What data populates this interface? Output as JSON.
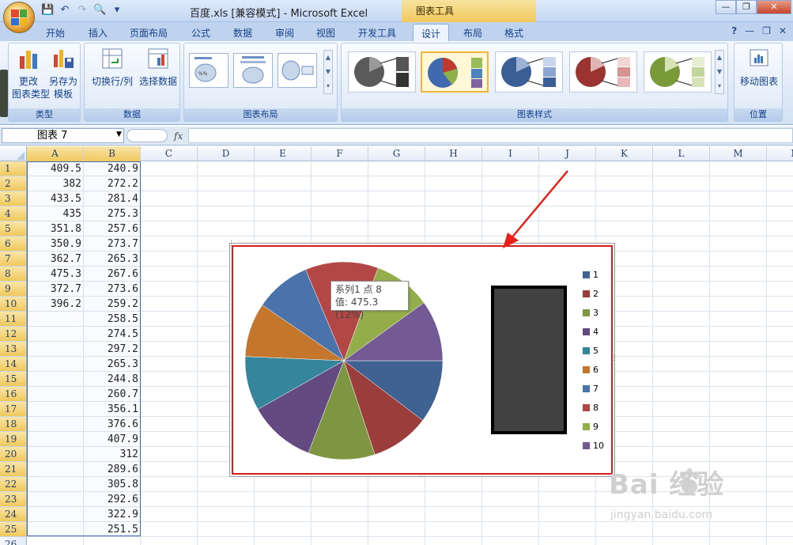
{
  "window": {
    "title": "百度.xls  [兼容模式] - Microsoft Excel",
    "tool_context": "图表工具",
    "controls": {
      "minimize": "—",
      "restore": "❐",
      "close": "✕"
    }
  },
  "quick_access": {
    "save": "💾",
    "undo": "↶",
    "redo": "↷",
    "print_preview": "🔍",
    "customize": "▾"
  },
  "ribbon_tabs": [
    "开始",
    "插入",
    "页面布局",
    "公式",
    "数据",
    "审阅",
    "视图",
    "开发工具",
    "设计",
    "布局",
    "格式"
  ],
  "active_tab": "设计",
  "help": "?",
  "ribbon": {
    "type_group": {
      "label": "类型",
      "change_type_label": "更改\n图表类型",
      "save_template_label": "另存为\n模板"
    },
    "data_group": {
      "label": "数据",
      "switch_label": "切换行/列",
      "select_label": "选择数据"
    },
    "layout_group": {
      "label": "图表布局"
    },
    "styles_group": {
      "label": "图表样式"
    },
    "position_group": {
      "label": "位置",
      "move_label": "移动图表"
    }
  },
  "formula_bar": {
    "name_box": "图表 7",
    "fx": "fx",
    "formula": ""
  },
  "columns": [
    "A",
    "B",
    "C",
    "D",
    "E",
    "F",
    "G",
    "H",
    "I",
    "J",
    "K",
    "L",
    "M",
    "N"
  ],
  "rows": [
    "1",
    "2",
    "3",
    "4",
    "5",
    "6",
    "7",
    "8",
    "9",
    "10",
    "11",
    "12",
    "13",
    "14",
    "15",
    "16",
    "17",
    "18",
    "19",
    "20",
    "21",
    "22",
    "23",
    "24",
    "25",
    "26"
  ],
  "col_a": [
    "409.5",
    "382",
    "433.5",
    "435",
    "351.8",
    "350.9",
    "362.7",
    "475.3",
    "372.7",
    "396.2"
  ],
  "col_b": [
    "240.9",
    "272.2",
    "281.4",
    "275.3",
    "257.6",
    "273.7",
    "265.3",
    "267.6",
    "273.6",
    "259.2",
    "258.5",
    "274.5",
    "297.2",
    "265.3",
    "244.8",
    "260.7",
    "356.1",
    "376.6",
    "407.9",
    "312",
    "289.6",
    "305.8",
    "292.6",
    "322.9",
    "251.5"
  ],
  "chart_data": {
    "type": "pie",
    "categories": [
      "1",
      "2",
      "3",
      "4",
      "5",
      "6",
      "7",
      "8",
      "9",
      "10"
    ],
    "values": [
      409.5,
      382,
      433.5,
      435,
      351.8,
      350.9,
      362.7,
      475.3,
      372.7,
      396.2
    ],
    "colors": [
      "#3f6293",
      "#9b3d3a",
      "#7e9641",
      "#634a81",
      "#35859c",
      "#c4762c",
      "#4a73ab",
      "#b34746",
      "#93ad4b",
      "#735a94"
    ],
    "legend_position": "right",
    "legend": [
      "1",
      "2",
      "3",
      "4",
      "5",
      "6",
      "7",
      "8",
      "9",
      "10"
    ]
  },
  "tooltip": {
    "line1": "系列1 点 8",
    "line2": "值: 475.3 (12%)"
  },
  "watermark": {
    "brand": "Bai  经验",
    "url": "jingyan.baidu.com"
  }
}
